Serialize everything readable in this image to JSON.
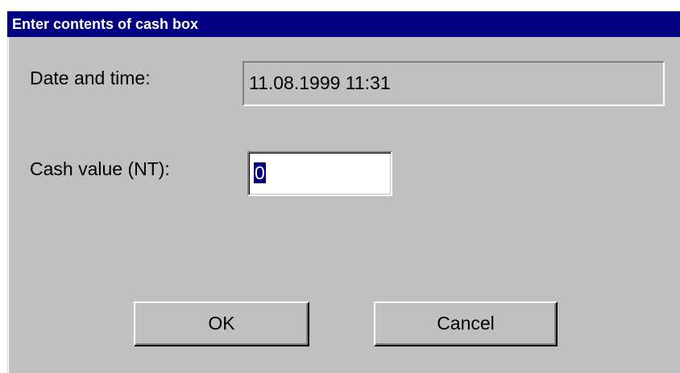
{
  "dialog": {
    "title": "Enter contents of cash box",
    "date_label": "Date and time:",
    "date_value": "11.08.1999 11:31",
    "cash_label": "Cash value (NT):",
    "cash_value": "0",
    "ok_label": "OK",
    "cancel_label": "Cancel"
  },
  "colors": {
    "titlebar": "#000080",
    "face": "#c0c0c0",
    "selection": "#000080"
  }
}
